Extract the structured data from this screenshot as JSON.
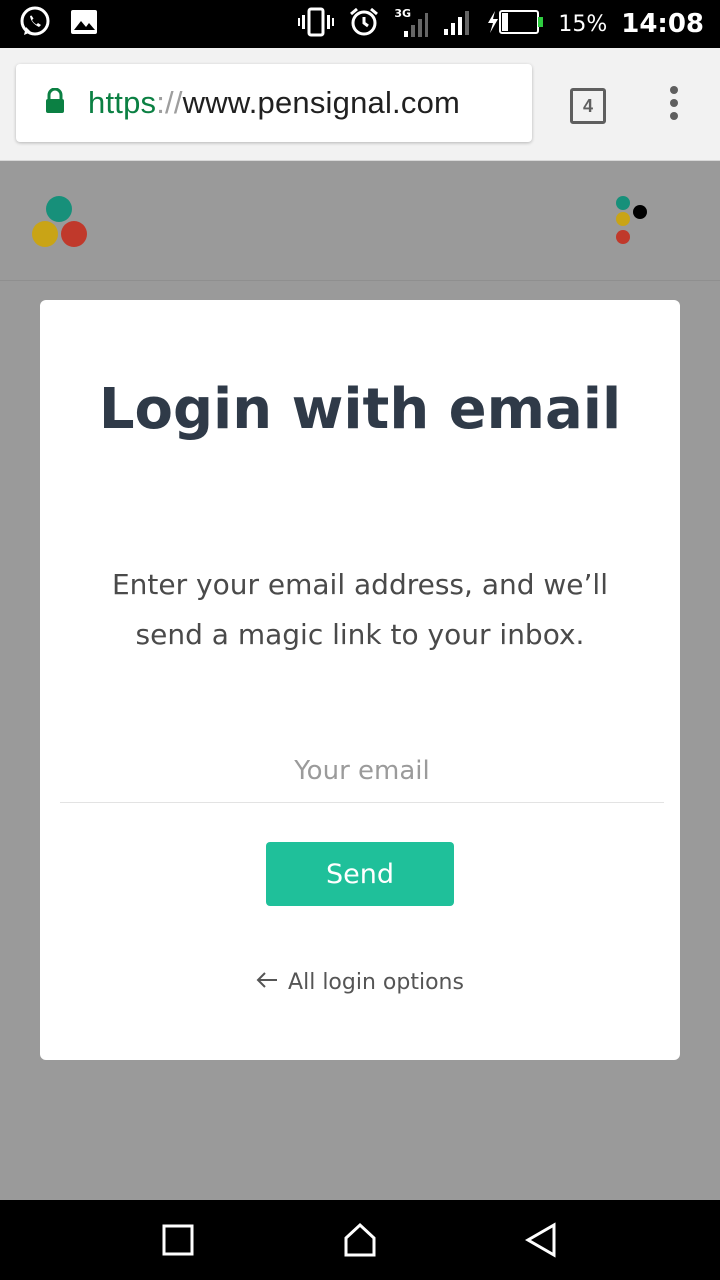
{
  "status_bar": {
    "battery_percent": "15%",
    "time": "14:08",
    "network_label": "3G",
    "icons": [
      "whatsapp-icon",
      "image-icon",
      "vibrate-icon",
      "alarm-icon",
      "signal-icon",
      "battery-charging-icon"
    ]
  },
  "browser": {
    "url_scheme": "https",
    "url_separator": "://",
    "url_host": "www.pensignal.com",
    "tab_count": "4"
  },
  "modal": {
    "title": "Login with email",
    "subtitle": "Enter your email address, and we’ll send a magic link to your inbox.",
    "email_placeholder": "Your email",
    "send_label": "Send",
    "back_label": "All login options"
  },
  "colors": {
    "accent": "#1fc09a",
    "logo_teal": "#17907a",
    "logo_yellow": "#c9a416",
    "logo_red": "#c0392b",
    "url_green": "#0b8043"
  }
}
